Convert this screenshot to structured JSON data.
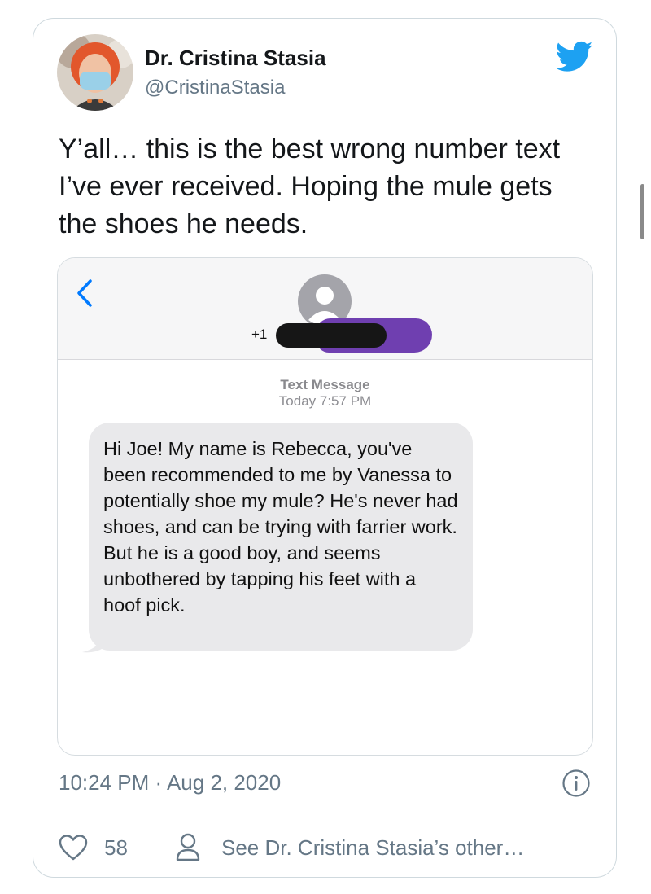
{
  "tweet": {
    "author_name": "Dr. Cristina Stasia",
    "author_handle": "@CristinaStasia",
    "text": "Y’all… this is the best wrong number text I’ve ever received. Hoping the mule gets the shoes he needs.",
    "timestamp": "10:24 PM · Aug 2, 2020",
    "like_count": "58",
    "see_other_label": "See Dr. Cristina Stasia’s other…"
  },
  "embedded_screenshot": {
    "contact_number_prefix": "+1",
    "meta_label": "Text Message",
    "meta_time": "Today 7:57 PM",
    "message_text": "Hi Joe! My name is Rebecca, you've been recommended to me by Vanessa to potentially shoe my mule? He's never had shoes, and can be trying with farrier work. But he is a good boy, and seems unbothered by tapping his feet with a hoof pick."
  },
  "icons": {
    "brand": "twitter-bird-icon",
    "back": "chevron-left-icon",
    "contact": "contact-avatar-icon",
    "info": "info-icon",
    "like": "heart-icon",
    "profile": "person-icon"
  },
  "colors": {
    "twitter_blue": "#1da1f2",
    "ios_blue": "#007aff",
    "secondary_text": "#657786",
    "redaction_purple": "#6f3fb0",
    "bubble_gray": "#e9e9eb"
  }
}
